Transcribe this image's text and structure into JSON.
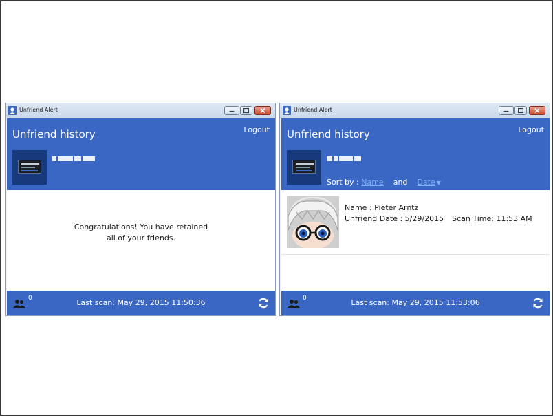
{
  "left_window": {
    "title": "Unfriend Alert",
    "header": {
      "title": "Unfriend history",
      "logout": "Logout"
    },
    "message_line1": "Congratulations! You have retained",
    "message_line2": "all of your friends.",
    "footer": {
      "friends_count": "0",
      "last_scan": "Last scan: May 29, 2015 11:50:36"
    }
  },
  "right_window": {
    "title": "Unfriend Alert",
    "header": {
      "title": "Unfriend history",
      "logout": "Logout"
    },
    "sort": {
      "label": "Sort by :",
      "name": "Name",
      "and": "and",
      "date": "Date"
    },
    "entries": [
      {
        "name": "Name : Pieter Arntz",
        "unfriend_date": "Unfriend Date : 5/29/2015",
        "scan_time": "Scan Time: 11:53 AM"
      }
    ],
    "footer": {
      "friends_count": "0",
      "last_scan": "Last scan: May 29, 2015 11:53:06"
    }
  },
  "colors": {
    "accent": "#3a66c4",
    "link": "#7fb0f2"
  },
  "icons": [
    "user-icon",
    "minimize-icon",
    "maximize-icon",
    "close-icon",
    "friends-icon",
    "refresh-icon",
    "chevron-down-icon"
  ]
}
